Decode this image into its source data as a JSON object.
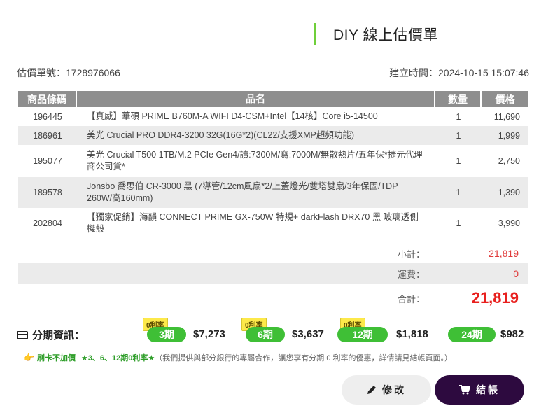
{
  "header": {
    "title": "DIY 線上估價單"
  },
  "meta": {
    "quote_no": "估價單號：1728976066",
    "created": "建立時間：2024-10-15 15:07:46"
  },
  "table": {
    "headers": {
      "code": "商品條碼",
      "name": "品名",
      "qty": "數量",
      "price": "價格"
    },
    "rows": [
      {
        "code": "196445",
        "name": "【真威】華碩 PRIME B760M-A WIFI D4-CSM+Intel【14核】Core i5-14500",
        "qty": "1",
        "price": "11,690"
      },
      {
        "code": "186961",
        "name": "美光 Crucial PRO DDR4-3200 32G(16G*2)(CL22/支援XMP超頻功能)",
        "qty": "1",
        "price": "1,999"
      },
      {
        "code": "195077",
        "name": "美光 Crucial T500 1TB/M.2 PCIe Gen4/讀:7300M/寫:7000M/無散熱片/五年保*捷元代理商公司貨*",
        "qty": "1",
        "price": "2,750"
      },
      {
        "code": "189578",
        "name": "Jonsbo 喬思伯 CR-3000 黑 (7導管/12cm風扇*2/上蓋燈光/雙塔雙扇/3年保固/TDP 260W/高160mm)",
        "qty": "1",
        "price": "1,390"
      },
      {
        "code": "202804",
        "name": "【獨家促銷】海韻 CONNECT PRIME GX-750W 特規+ darkFlash DRX70 黑 玻璃透側機殼",
        "qty": "1",
        "price": "3,990"
      }
    ]
  },
  "summary": {
    "subtotal_label": "小計：",
    "subtotal": "21,819",
    "shipping_label": "運費：",
    "shipping": "0",
    "total_label": "合計：",
    "total": "21,819"
  },
  "installment": {
    "label": "分期資訊：",
    "plans": [
      {
        "badge": "0利率",
        "term": "3期",
        "amount": "$7,273"
      },
      {
        "badge": "0利率",
        "term": "6期",
        "amount": "$3,637"
      },
      {
        "badge": "0利率",
        "term": "12期",
        "amount": "$1,818"
      },
      {
        "badge": "",
        "term": "24期",
        "amount": "$982"
      }
    ]
  },
  "promo": {
    "part1": "刷卡不加價",
    "part2": "★3、6、12期0利率★",
    "part3": "（我們提供與部分銀行的專屬合作，讓您享有分期 0 利率的優惠，詳情請見結帳頁面。）"
  },
  "buttons": {
    "edit": "修改",
    "checkout": "結帳"
  },
  "colors": {
    "accent_green": "#3fbf36",
    "total_red": "#e8201e",
    "checkout_bg": "#2d0a3f"
  },
  "icons": {
    "installment": "credit-card-icon",
    "promo": "pointing-hand-icon",
    "edit": "pencil-icon",
    "checkout": "cart-icon"
  }
}
